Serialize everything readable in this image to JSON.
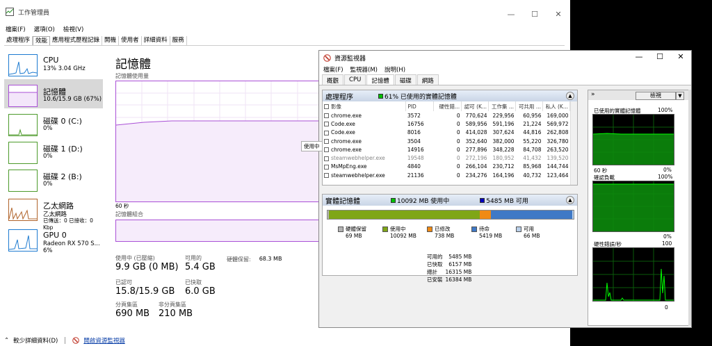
{
  "taskmgr": {
    "title": "工作管理員",
    "menu": [
      "檔案(F)",
      "選項(O)",
      "檢視(V)"
    ],
    "tabs": [
      "處理程序",
      "效能",
      "應用程式歷程記錄",
      "開機",
      "使用者",
      "詳細資料",
      "服務"
    ],
    "sidebar": [
      {
        "name": "CPU",
        "sub": "13% 3.04 GHz",
        "sub2": ""
      },
      {
        "name": "記憶體",
        "sub": "10.6/15.9 GB (67%)",
        "sub2": ""
      },
      {
        "name": "磁碟 0 (C:)",
        "sub": "0%",
        "sub2": ""
      },
      {
        "name": "磁碟 1 (D:)",
        "sub": "0%",
        "sub2": ""
      },
      {
        "name": "磁碟 2 (B:)",
        "sub": "0%",
        "sub2": ""
      },
      {
        "name": "乙太網路",
        "sub": "乙太網路",
        "sub2": "已傳送：0 已接收：0 Kbp"
      },
      {
        "name": "GPU 0",
        "sub": "Radeon RX 570 S...",
        "sub2": "6%"
      }
    ],
    "main": {
      "heading": "記憶體",
      "usage_label": "記憶體使用量",
      "sixty": "60 秒",
      "composition_label": "記憶體組合",
      "tooltip": "使用中",
      "stats": {
        "in_use_k": "使用中 (已壓縮)",
        "in_use_v": "9.9 GB (0 MB)",
        "avail_k": "可用的",
        "avail_v": "5.4 GB",
        "reserved_k": "硬體保留:",
        "reserved_v": "68.3 MB",
        "committed_k": "已認可",
        "committed_v": "15.8/15.9 GB",
        "cached_k": "已快取",
        "cached_v": "6.0 GB",
        "paged_k": "分頁集區",
        "paged_v": "690 MB",
        "nonpaged_k": "非分頁集區",
        "nonpaged_v": "210 MB"
      }
    },
    "footer": {
      "fewer": "較少詳細資料(D)",
      "open_rm": "開啟資源監視器"
    }
  },
  "resmon": {
    "title": "資源監視器",
    "menu": [
      "檔案(F)",
      "監視器(M)",
      "說明(H)"
    ],
    "tabs": [
      "概觀",
      "CPU",
      "記憶體",
      "磁碟",
      "網路"
    ],
    "proc_panel": {
      "title": "處理程序",
      "badge": "61% 已使用的實體記憶體",
      "headers": [
        "影像",
        "PID",
        "硬性錯...",
        "認可 (K...",
        "工作集 ...",
        "可共用 ...",
        "私人 (K..."
      ],
      "rows": [
        [
          "chrome.exe",
          "3572",
          "0",
          "770,624",
          "229,956",
          "60,956",
          "169,000"
        ],
        [
          "Code.exe",
          "16756",
          "0",
          "589,956",
          "591,196",
          "21,224",
          "569,972"
        ],
        [
          "Code.exe",
          "8016",
          "0",
          "414,028",
          "307,624",
          "44,816",
          "262,808"
        ],
        [
          "chrome.exe",
          "3504",
          "0",
          "352,640",
          "382,000",
          "55,220",
          "326,780"
        ],
        [
          "chrome.exe",
          "14916",
          "0",
          "277,896",
          "348,228",
          "84,708",
          "263,520"
        ],
        [
          "steamwebhelper.exe",
          "19548",
          "0",
          "272,196",
          "180,952",
          "41,432",
          "139,520"
        ],
        [
          "MsMpEng.exe",
          "4840",
          "0",
          "266,104",
          "230,712",
          "85,968",
          "144,744"
        ],
        [
          "steamwebhelper.exe",
          "21136",
          "0",
          "234,276",
          "164,196",
          "40,732",
          "123,464"
        ]
      ],
      "dim_rows": [
        5
      ]
    },
    "phys_panel": {
      "title": "實體記憶體",
      "inuse_badge": "10092 MB 使用中",
      "avail_badge": "5485 MB 可用",
      "legend": [
        {
          "label": "硬體保留",
          "value": "69 MB",
          "color": "#b3b3b3"
        },
        {
          "label": "使用中",
          "value": "10092 MB",
          "color": "#7fa617"
        },
        {
          "label": "已修改",
          "value": "738 MB",
          "color": "#f08a14"
        },
        {
          "label": "待命",
          "value": "5419 MB",
          "color": "#3f79c6"
        },
        {
          "label": "可用",
          "value": "66 MB",
          "color": "#b9cfe9"
        }
      ],
      "summary": [
        [
          "可用的",
          "5485 MB"
        ],
        [
          "已快取",
          "6157 MB"
        ],
        [
          "總計",
          "16315 MB"
        ],
        [
          "已安裝",
          "16384 MB"
        ]
      ]
    },
    "right": {
      "view_btn": "檢視",
      "g1_label": "已使用的實體記憶體",
      "g1_max": "100%",
      "g1_min": "0%",
      "sixty": "60 秒",
      "g2_label": "確認負載",
      "g2_max": "100%",
      "g2_min": "0%",
      "g3_label": "硬性錯誤/秒",
      "g3_max": "100",
      "g3_min": "0"
    }
  },
  "colors": {
    "accent_purple": "#a94fd6",
    "green": "#00c000"
  }
}
